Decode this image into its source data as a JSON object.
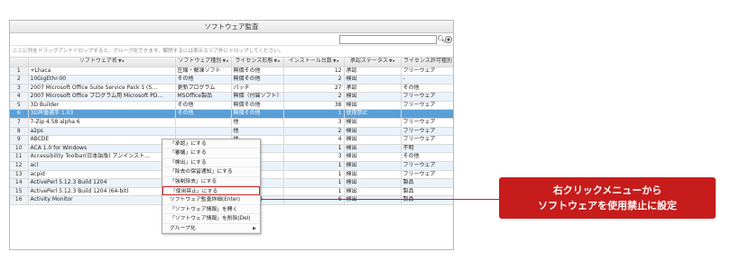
{
  "window": {
    "title": "ソフトウェア監査"
  },
  "search": {
    "value": "",
    "placeholder": ""
  },
  "group_hint": "ここに列をドラッグアンドドロップすると、グループ化できます。解除するには表示エリア外にドロップしてください。",
  "columns": [
    "ソフトウェア名",
    "ソフトウェア種別",
    "ライセンス形態",
    "インストール台数",
    "承認ステータス",
    "ライセンス許可種別"
  ],
  "rows": [
    {
      "num": "1",
      "name": "+Lhaca",
      "type": "圧縮・解凍ソフト",
      "license": "無償その他",
      "count": "12",
      "status": "承認",
      "perm": "フリーウェア"
    },
    {
      "num": "2",
      "name": "10GigEthr-00",
      "type": "その他",
      "license": "無償その他",
      "count": "2",
      "status": "検出",
      "perm": "-"
    },
    {
      "num": "3",
      "name": "2007 Microsoft Office Suite Service Pack 1 (S…",
      "type": "更新プログラム",
      "license": "パッチ",
      "count": "27",
      "status": "承認",
      "perm": "その他"
    },
    {
      "num": "4",
      "name": "2007 Microsoft Office プログラム用 Microsoft PD…",
      "type": "MSOffice製品",
      "license": "無償（付属ソフト）",
      "count": "2",
      "status": "検出",
      "perm": "フリーウェア"
    },
    {
      "num": "5",
      "name": "3D Builder",
      "type": "その他",
      "license": "無償その他",
      "count": "38",
      "status": "検出",
      "perm": "フリーウェア"
    },
    {
      "num": "6",
      "name": "3D声優選手 1.03",
      "type": "その他",
      "license": "無償その他",
      "count": "1",
      "status": "使用禁止",
      "perm": ""
    },
    {
      "num": "7",
      "name": "7-Zip 4.58 alpha 6",
      "type": "",
      "license": "他",
      "count": "3",
      "status": "検出",
      "perm": "フリーウェア"
    },
    {
      "num": "8",
      "name": "a2ps",
      "type": "",
      "license": "他",
      "count": "2",
      "status": "検出",
      "perm": "フリーウェア"
    },
    {
      "num": "9",
      "name": "ABCDE",
      "type": "",
      "license": "他",
      "count": "4",
      "status": "検出",
      "perm": "フリーウェア"
    },
    {
      "num": "10",
      "name": "ACA 1.0 for Windows",
      "type": "",
      "license": "他",
      "count": "1",
      "status": "検出",
      "perm": "不明"
    },
    {
      "num": "11",
      "name": "Accessibility Toolbar(日本語版) アンインスト…",
      "type": "",
      "license": "の他",
      "count": "3",
      "status": "検出",
      "perm": "その他"
    },
    {
      "num": "12",
      "name": "acl",
      "type": "",
      "license": "他",
      "count": "1",
      "status": "検出",
      "perm": "フリーウェア"
    },
    {
      "num": "13",
      "name": "acpid",
      "type": "",
      "license": "他",
      "count": "1",
      "status": "検出",
      "perm": "フリーウェア"
    },
    {
      "num": "14",
      "name": "ActivePerl 5.12.3 Build 1204",
      "type": "",
      "license": "",
      "count": "1",
      "status": "検出",
      "perm": "製品"
    },
    {
      "num": "15",
      "name": "ActivePerl 5.12.3 Build 1204 (64-bit)",
      "type": "",
      "license": "",
      "count": "1",
      "status": "検出",
      "perm": "製品"
    },
    {
      "num": "16",
      "name": "Activity Monitor",
      "type": "",
      "license": "付属ソフト)",
      "count": "6",
      "status": "検出",
      "perm": "製品"
    }
  ],
  "selected_row": 6,
  "context_menu": {
    "items": [
      "「承認」にする",
      "「審議」にする",
      "「検出」にする",
      "「除去の保留通知」にする",
      "「強制除去」にする",
      "「使用禁止」にする",
      "ソフトウェア監査詳細(Enter)",
      "「ソフトウェア情報」を開く",
      "「ソフトウェア情報」を削除(Del)",
      "グループ化"
    ]
  },
  "callout": {
    "line1": "右クリックメニューから",
    "line2": "ソフトウェアを使用禁止に設定"
  },
  "colors": {
    "accent": "#c71c1c",
    "selected_row": "#5a9fd8",
    "alt_row": "#eaf3fb"
  }
}
